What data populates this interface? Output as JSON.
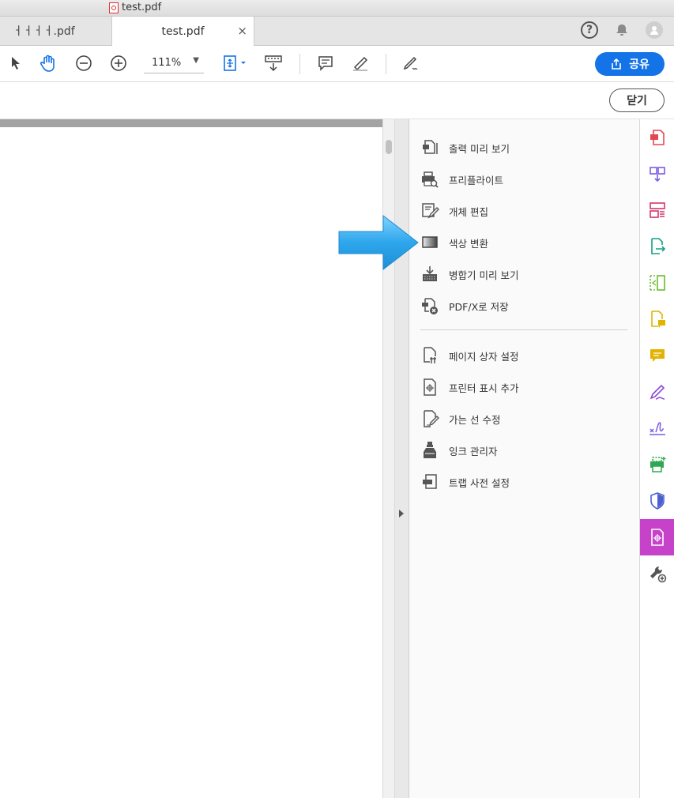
{
  "window": {
    "title": "test.pdf"
  },
  "tabs": [
    {
      "label": "ㅓㅓㅓㅓ.pdf"
    },
    {
      "label": "test.pdf",
      "close": "×"
    }
  ],
  "header_icons": [
    "help-icon",
    "bell-icon",
    "user-icon"
  ],
  "toolbar": {
    "zoom_value": "111%",
    "share_label": "공유"
  },
  "secondary_bar": {
    "close_label": "닫기"
  },
  "tool_panel": {
    "group1": [
      {
        "label": "출력 미리 보기",
        "icon": "output-preview-icon"
      },
      {
        "label": "프리플라이트",
        "icon": "preflight-icon"
      },
      {
        "label": "개체 편집",
        "icon": "edit-object-icon"
      },
      {
        "label": "색상 변환",
        "icon": "convert-colors-icon"
      },
      {
        "label": "병합기 미리 보기",
        "icon": "flattener-preview-icon"
      },
      {
        "label": "PDF/X로 저장",
        "icon": "save-pdfx-icon"
      }
    ],
    "group2": [
      {
        "label": "페이지 상자 설정",
        "icon": "set-page-boxes-icon"
      },
      {
        "label": "프린터 표시 추가",
        "icon": "add-printer-marks-icon"
      },
      {
        "label": "가는 선 수정",
        "icon": "fix-hairlines-icon"
      },
      {
        "label": "잉크 관리자",
        "icon": "ink-manager-icon"
      },
      {
        "label": "트랩 사전 설정",
        "icon": "trap-presets-icon"
      }
    ]
  },
  "right_rail": {
    "colors": {
      "red": "#e34850",
      "purple": "#7b5ce6",
      "pink": "#d6336c",
      "teal": "#12a089",
      "green": "#6bbd2a",
      "yellow": "#e2b300",
      "violet": "#8a48d6",
      "active": "#c542c9"
    },
    "active_tool": "print-production"
  },
  "annotation": {
    "arrow_color": "#2da6ec",
    "points_to": "색상 변환"
  }
}
